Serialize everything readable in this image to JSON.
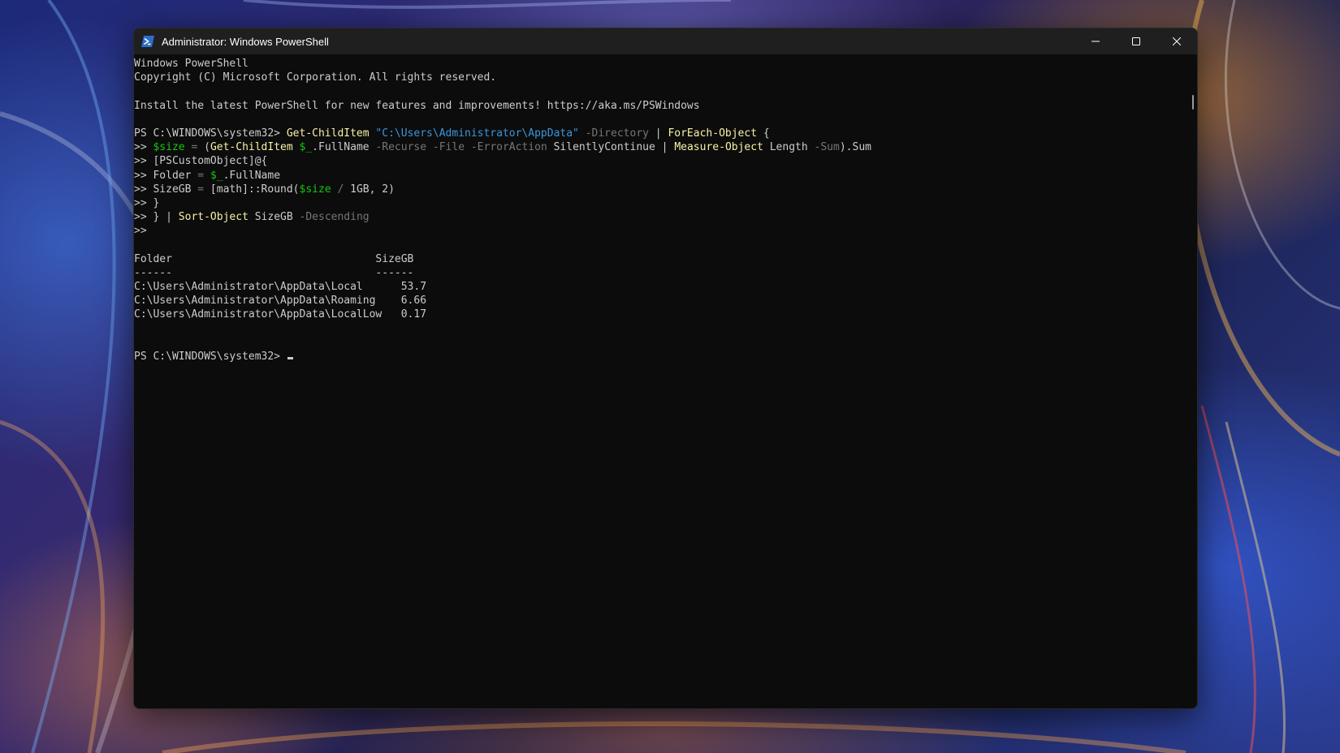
{
  "window": {
    "title": "Administrator: Windows PowerShell",
    "icon": "powershell-icon",
    "controls": [
      "minimize-icon",
      "maximize-icon",
      "close-icon"
    ]
  },
  "colors": {
    "background": "#0c0c0c",
    "text": "#cccccc",
    "command": "#f9f1a5",
    "string": "#3a96dd",
    "parameter": "#767676",
    "variable": "#16c60c",
    "titlebar": "#1f1f1f"
  },
  "console": {
    "lines": [
      [
        {
          "t": "Windows PowerShell",
          "c": "def"
        }
      ],
      [
        {
          "t": "Copyright (C) Microsoft Corporation. All rights reserved.",
          "c": "def"
        }
      ],
      [],
      [
        {
          "t": "Install the latest PowerShell for new features and improvements! https://aka.ms/PSWindows",
          "c": "def"
        }
      ],
      [],
      [
        {
          "t": "PS C:\\WINDOWS\\system32> ",
          "c": "def"
        },
        {
          "t": "Get-ChildItem",
          "c": "cmd"
        },
        {
          "t": " ",
          "c": "def"
        },
        {
          "t": "\"C:\\Users\\Administrator\\AppData\"",
          "c": "str"
        },
        {
          "t": " -Directory",
          "c": "param"
        },
        {
          "t": " | ",
          "c": "def"
        },
        {
          "t": "ForEach-Object",
          "c": "cmd"
        },
        {
          "t": " {",
          "c": "def"
        }
      ],
      [
        {
          "t": ">> ",
          "c": "def"
        },
        {
          "t": "$size",
          "c": "var"
        },
        {
          "t": " = ",
          "c": "param"
        },
        {
          "t": "(",
          "c": "def"
        },
        {
          "t": "Get-ChildItem",
          "c": "cmd"
        },
        {
          "t": " ",
          "c": "def"
        },
        {
          "t": "$_",
          "c": "var"
        },
        {
          "t": ".FullName",
          "c": "def"
        },
        {
          "t": " -Recurse -File -ErrorAction",
          "c": "param"
        },
        {
          "t": " SilentlyContinue | ",
          "c": "def"
        },
        {
          "t": "Measure-Object",
          "c": "cmd"
        },
        {
          "t": " Length",
          "c": "def"
        },
        {
          "t": " -Sum",
          "c": "param"
        },
        {
          "t": ").Sum",
          "c": "def"
        }
      ],
      [
        {
          "t": ">> [PSCustomObject]@{",
          "c": "def"
        }
      ],
      [
        {
          "t": ">> Folder ",
          "c": "def"
        },
        {
          "t": "=",
          "c": "param"
        },
        {
          "t": " ",
          "c": "def"
        },
        {
          "t": "$_",
          "c": "var"
        },
        {
          "t": ".FullName",
          "c": "def"
        }
      ],
      [
        {
          "t": ">> SizeGB ",
          "c": "def"
        },
        {
          "t": "=",
          "c": "param"
        },
        {
          "t": " [math]::Round(",
          "c": "def"
        },
        {
          "t": "$size",
          "c": "var"
        },
        {
          "t": " / ",
          "c": "param"
        },
        {
          "t": "1GB, 2)",
          "c": "def"
        }
      ],
      [
        {
          "t": ">> }",
          "c": "def"
        }
      ],
      [
        {
          "t": ">> } | ",
          "c": "def"
        },
        {
          "t": "Sort-Object",
          "c": "cmd"
        },
        {
          "t": " SizeGB",
          "c": "def"
        },
        {
          "t": " -Descending",
          "c": "param"
        }
      ],
      [
        {
          "t": ">>",
          "c": "def"
        }
      ],
      [],
      [
        {
          "t": "Folder                                SizeGB",
          "c": "def"
        }
      ],
      [
        {
          "t": "------                                ------",
          "c": "def"
        }
      ],
      [
        {
          "t": "C:\\Users\\Administrator\\AppData\\Local      53.7",
          "c": "def"
        }
      ],
      [
        {
          "t": "C:\\Users\\Administrator\\AppData\\Roaming    6.66",
          "c": "def"
        }
      ],
      [
        {
          "t": "C:\\Users\\Administrator\\AppData\\LocalLow   0.17",
          "c": "def"
        }
      ],
      [],
      [],
      [
        {
          "t": "PS C:\\WINDOWS\\system32> ",
          "c": "def"
        }
      ]
    ],
    "cursor_line": 21
  }
}
